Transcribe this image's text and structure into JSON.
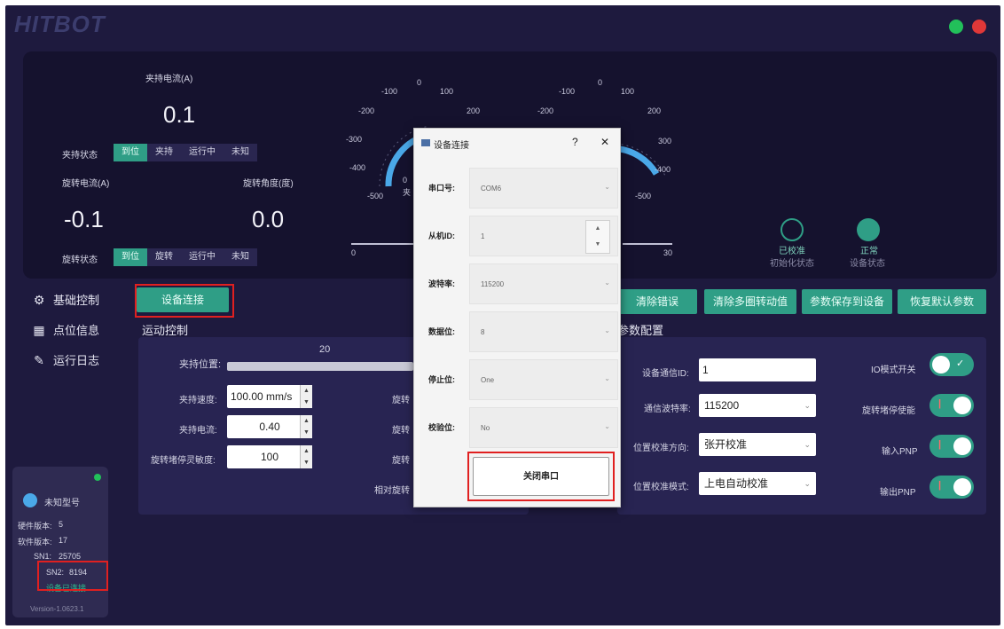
{
  "app": {
    "logo_text": "HITBOT",
    "colors": {
      "bg": "#1e1a3e",
      "panel": "#15122e",
      "accent": "#2f9e86",
      "highlight": "#e02020",
      "gauge": "#4aa8e8"
    }
  },
  "grip": {
    "current_label": "夹持电流(A)",
    "current_value": "0.1",
    "state_label": "夹持状态",
    "states": [
      "到位",
      "夹持",
      "运行中",
      "未知"
    ],
    "active_state_index": 0
  },
  "rotate": {
    "current_label": "旋转电流(A)",
    "current_value": "-0.1",
    "angle_label": "旋转角度(度)",
    "angle_value": "0.0",
    "state_label": "旋转状态",
    "states": [
      "到位",
      "旋转",
      "运行中",
      "未知"
    ],
    "active_state_index": 0
  },
  "gauges": {
    "ticks_left": [
      "-100",
      "0",
      "100",
      "200",
      "300",
      "-200",
      "-300",
      "-400",
      "-500"
    ],
    "left_partial": [
      "0",
      "夹"
    ],
    "ruler_start": "0",
    "ruler_end": "30"
  },
  "status": {
    "calib_title": "已校准",
    "calib_sub": "初始化状态",
    "device_title": "正常",
    "device_sub": "设备状态"
  },
  "nav": {
    "items": [
      {
        "label": "基础控制",
        "icon": "settings-gear-icon"
      },
      {
        "label": "点位信息",
        "icon": "grid-icon"
      },
      {
        "label": "运行日志",
        "icon": "log-edit-icon"
      }
    ]
  },
  "toolbar": {
    "connect_button": "设备连接",
    "clear_error": "清除错误",
    "clear_multi": "清除多圈转动值",
    "save_params": "参数保存到设备",
    "restore_default": "恢复默认参数"
  },
  "motion": {
    "title": "运动控制",
    "position_label": "夹持位置:",
    "slider_value": "20",
    "speed_label": "夹持速度:",
    "speed_value": "100.00 mm/s",
    "current_label": "夹持电流:",
    "current_value": "0.40",
    "sensitivity_label": "旋转堵停灵敏度:",
    "sensitivity_value": "100",
    "partial_labels": [
      "旋转",
      "旋转",
      "旋转",
      "相对旋转"
    ]
  },
  "params": {
    "title": "参数配置",
    "comm_id_label": "设备通信ID:",
    "comm_id_value": "1",
    "baud_label": "通信波特率:",
    "baud_value": "115200",
    "calib_dir_label": "位置校准方向:",
    "calib_dir_value": "张开校准",
    "calib_mode_label": "位置校准模式:",
    "calib_mode_value": "上电自动校准",
    "io_mode_label": "IO模式开关",
    "rot_stall_label": "旋转堵停使能",
    "input_pnp_label": "输入PNP",
    "output_pnp_label": "输出PNP"
  },
  "device": {
    "model": "未知型号",
    "hw_label": "硬件版本:",
    "hw_value": "5",
    "sw_label": "软件版本:",
    "sw_value": "17",
    "sn1_label": "SN1:",
    "sn1_value": "25705",
    "sn2_label": "SN2:",
    "sn2_value": "8194",
    "conn_status": "设备已连接",
    "version": "Version-1.0623.1"
  },
  "dialog": {
    "title": "设备连接",
    "help": "?",
    "close": "✕",
    "port_label": "串口号:",
    "port_value": "COM6",
    "slave_label": "从机ID:",
    "slave_value": "1",
    "baud_label": "波特率:",
    "baud_value": "115200",
    "databits_label": "数据位:",
    "databits_value": "8",
    "stopbits_label": "停止位:",
    "stopbits_value": "One",
    "parity_label": "校验位:",
    "parity_value": "No",
    "close_port_button": "关闭串口"
  }
}
